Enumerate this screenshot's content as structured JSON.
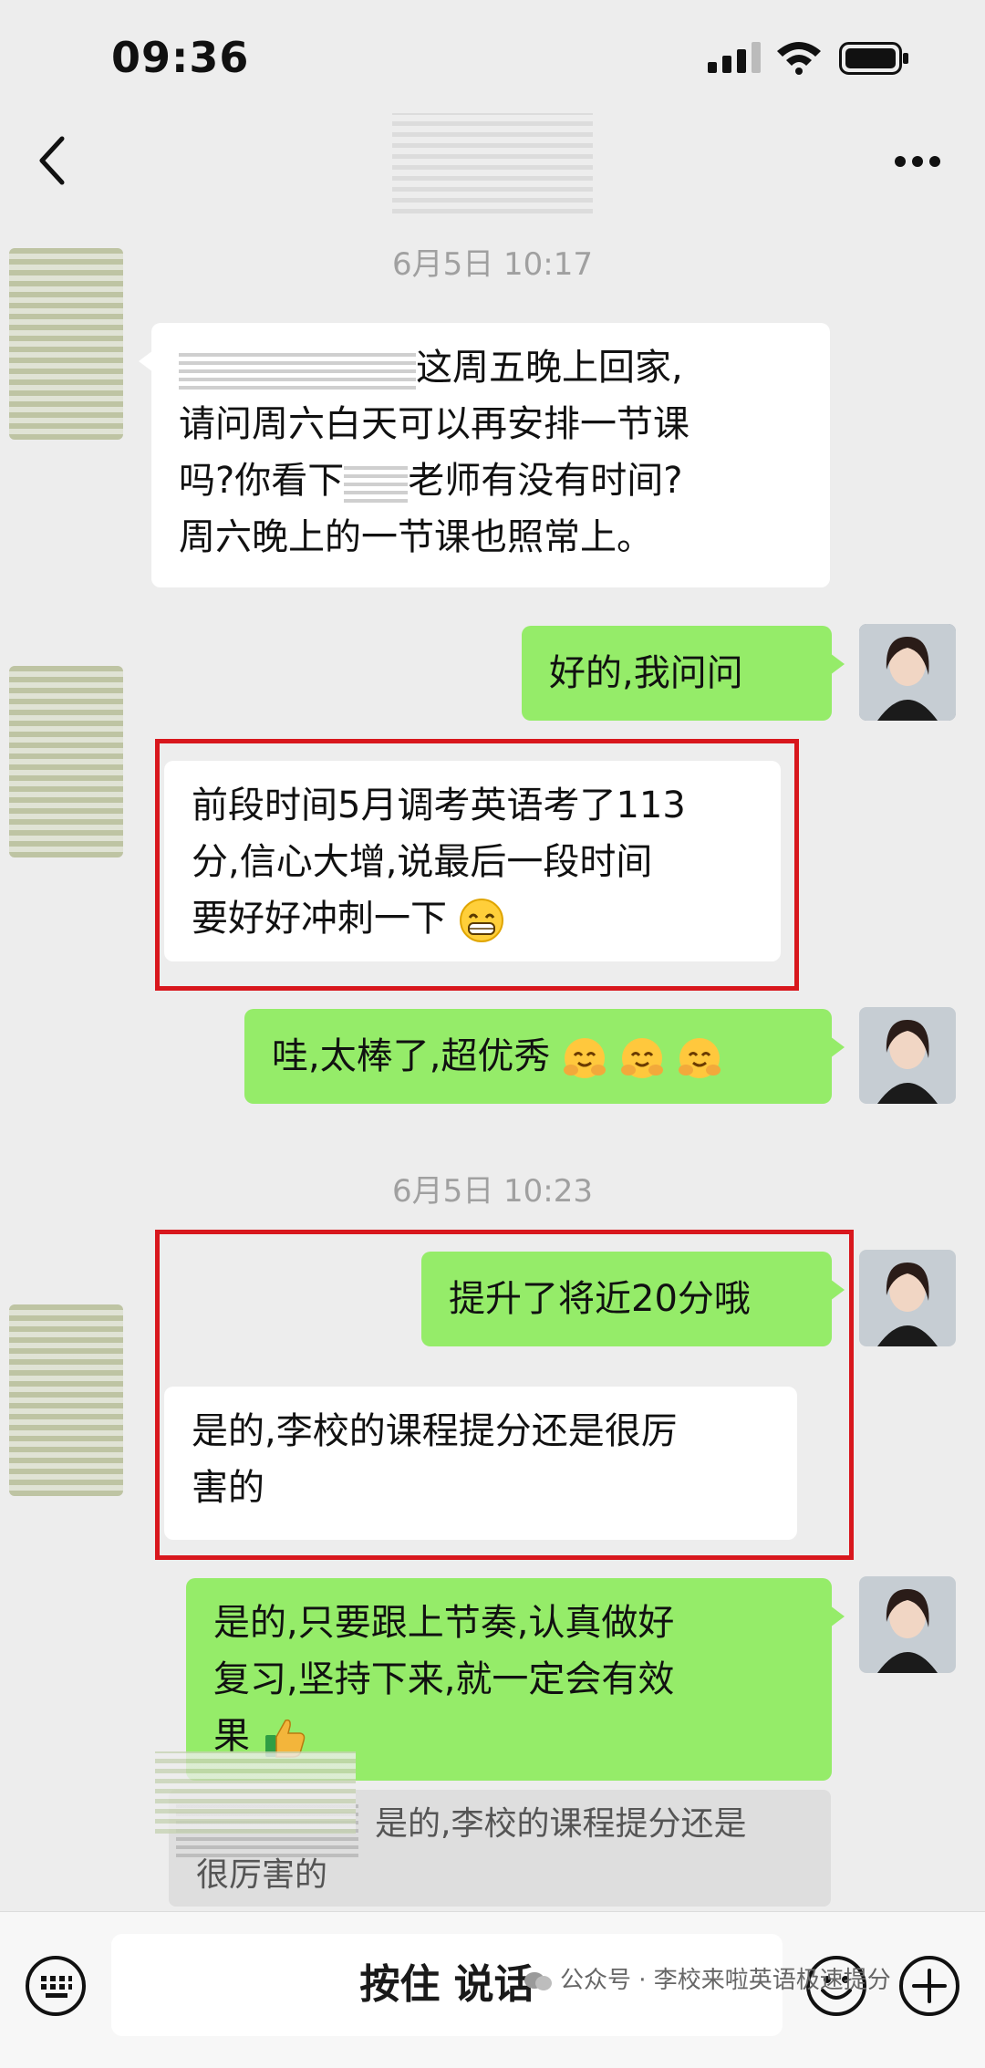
{
  "status_bar": {
    "time": "09:36"
  },
  "chat": {
    "timestamps": [
      "6月5日 10:17",
      "6月5日 10:23"
    ],
    "messages": [
      {
        "side": "left",
        "text_after_name": "这周五晚上回家,",
        "lines": [
          "请问周六白天可以再安排一节课",
          "吗?你看下",
          "老师有没有时间?",
          "周六晚上的一节课也照常上。"
        ]
      },
      {
        "side": "right",
        "text": "好的,我问问"
      },
      {
        "side": "left",
        "lines": [
          "前段时间5月调考英语考了113",
          "分,信心大增,说最后一段时间",
          "要好好冲刺一下"
        ],
        "emoji": "grin-emoji"
      },
      {
        "side": "right",
        "text": "哇,太棒了,超优秀",
        "emoji": "hug-emoji"
      },
      {
        "side": "right",
        "text": "提升了将近20分哦"
      },
      {
        "side": "left",
        "lines": [
          "是的,李校的课程提分还是很厉",
          "害的"
        ]
      },
      {
        "side": "right",
        "lines": [
          "是的,只要跟上节奏,认真做好",
          "复习,坚持下来,就一定会有效",
          "果"
        ],
        "emoji": "thumbs-up-emoji"
      }
    ],
    "quote": {
      "line1": "是的,李校的课程提分还是",
      "line2": "很厉害的"
    }
  },
  "input_bar": {
    "hold_to_talk": "按住 说话"
  },
  "watermark": "公众号 · 李校来啦英语极速提分",
  "colors": {
    "background": "#ededed",
    "bubble_right": "#95ec69",
    "bubble_left": "#ffffff",
    "highlight_box": "#d8171d"
  }
}
